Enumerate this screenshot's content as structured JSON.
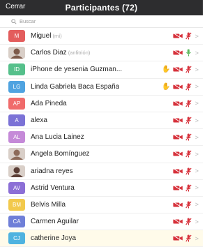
{
  "header": {
    "close_label": "Cerrar",
    "title": "Participantes (72)"
  },
  "search": {
    "placeholder": "Buscar"
  },
  "participants": [
    {
      "initials": "M",
      "name": "Miguel",
      "role": "(mí)",
      "color": "#e35d5d",
      "photo": false,
      "hand": false,
      "mic": "muted"
    },
    {
      "initials": "",
      "name": "Carlos Diaz",
      "role": "(anfitrión)",
      "color": "#7d5a4a",
      "photo": true,
      "hand": false,
      "mic": "on"
    },
    {
      "initials": "ID",
      "name": "iPhone de yesenia Guzman...",
      "role": "",
      "color": "#55c08b",
      "photo": false,
      "hand": true,
      "mic": "muted"
    },
    {
      "initials": "LG",
      "name": "Linda Gabriela Baca España",
      "role": "",
      "color": "#4fa3e0",
      "photo": false,
      "hand": true,
      "mic": "muted"
    },
    {
      "initials": "AP",
      "name": "Ada Pineda",
      "role": "",
      "color": "#f06b6b",
      "photo": false,
      "hand": false,
      "mic": "muted"
    },
    {
      "initials": "A",
      "name": "alexa",
      "role": "",
      "color": "#7b72d6",
      "photo": false,
      "hand": false,
      "mic": "muted"
    },
    {
      "initials": "AL",
      "name": "Ana Lucia Lainez",
      "role": "",
      "color": "#c58ad8",
      "photo": false,
      "hand": false,
      "mic": "muted"
    },
    {
      "initials": "",
      "name": "Angela Bomínguez",
      "role": "",
      "color": "#8d6b5a",
      "photo": true,
      "hand": false,
      "mic": "muted"
    },
    {
      "initials": "",
      "name": "ariadna reyes",
      "role": "",
      "color": "#5a3d35",
      "photo": true,
      "hand": false,
      "mic": "muted"
    },
    {
      "initials": "AV",
      "name": "Astrid Ventura",
      "role": "",
      "color": "#8c6fd6",
      "photo": false,
      "hand": false,
      "mic": "muted"
    },
    {
      "initials": "BM",
      "name": "Belvis Milla",
      "role": "",
      "color": "#f2c94c",
      "photo": false,
      "hand": false,
      "mic": "muted"
    },
    {
      "initials": "CA",
      "name": "Carmen Aguilar",
      "role": "",
      "color": "#6f7fd8",
      "photo": false,
      "hand": false,
      "mic": "muted"
    },
    {
      "initials": "CJ",
      "name": "catherine Joya",
      "role": "",
      "color": "#4fb3e0",
      "photo": false,
      "hand": false,
      "mic": "muted"
    }
  ],
  "colors": {
    "header_bg": "#2d2d2f",
    "muted_icon": "#d6303a",
    "mic_on": "#5cb85c"
  },
  "icons": {
    "search": "search-icon",
    "video_off": "video-off-icon",
    "mic_off": "mic-off-icon",
    "mic_on": "mic-on-icon",
    "raised_hand": "raised-hand-icon",
    "chevron": "chevron-right-icon"
  }
}
